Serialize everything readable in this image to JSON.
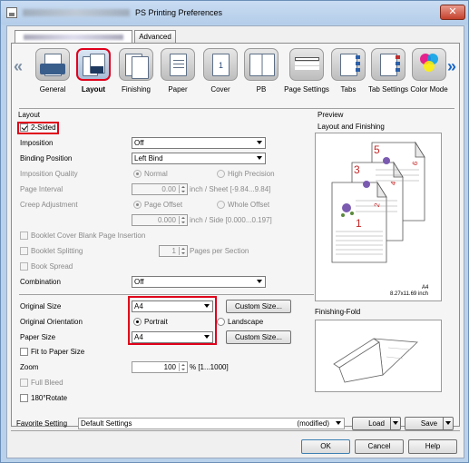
{
  "window": {
    "title": "PS Printing Preferences",
    "close_label": "✕"
  },
  "tabs": [
    {
      "label": ""
    },
    {
      "label": "Advanced"
    }
  ],
  "icon_tabs": [
    {
      "label": "General",
      "icon": "general-icon"
    },
    {
      "label": "Layout",
      "icon": "layout-icon",
      "selected": true
    },
    {
      "label": "Finishing",
      "icon": "finishing-icon"
    },
    {
      "label": "Paper",
      "icon": "paper-icon"
    },
    {
      "label": "Cover",
      "icon": "cover-icon"
    },
    {
      "label": "PB",
      "icon": "pb-icon"
    },
    {
      "label": "Page Settings",
      "icon": "page-settings-icon"
    },
    {
      "label": "Tabs",
      "icon": "tabs-icon"
    },
    {
      "label": "Tab Settings",
      "icon": "tab-settings-icon"
    },
    {
      "label": "Color Mode",
      "icon": "color-mode-icon"
    }
  ],
  "layout": {
    "group_title": "Layout",
    "two_sided": {
      "label": "2-Sided",
      "checked": true
    },
    "imposition": {
      "label": "Imposition",
      "value": "Off"
    },
    "binding_position": {
      "label": "Binding Position",
      "value": "Left Bind"
    },
    "imposition_quality": {
      "label": "Imposition Quality",
      "normal": "Normal",
      "high": "High Precision"
    },
    "page_interval": {
      "label": "Page Interval",
      "value": "0.00",
      "range": "inch / Sheet [-9.84...9.84]"
    },
    "creep_adjustment": {
      "label": "Creep Adjustment",
      "page_offset": "Page Offset",
      "whole_offset": "Whole Offset",
      "value": "0.000",
      "range": "inch / Side [0.000...0.197]"
    },
    "booklet_cover_blank": {
      "label": "Booklet Cover Blank Page Insertion"
    },
    "booklet_splitting": {
      "label": "Booklet Splitting",
      "value": "1",
      "unit": "Pages per Section"
    },
    "book_spread": {
      "label": "Book Spread"
    },
    "combination": {
      "label": "Combination",
      "value": "Off"
    },
    "original_size": {
      "label": "Original Size",
      "value": "A4",
      "button": "Custom Size..."
    },
    "original_orientation": {
      "label": "Original Orientation",
      "portrait": "Portrait",
      "landscape": "Landscape"
    },
    "paper_size": {
      "label": "Paper Size",
      "value": "A4",
      "button": "Custom Size..."
    },
    "fit_to_paper": {
      "label": "Fit to Paper Size"
    },
    "zoom": {
      "label": "Zoom",
      "value": "100",
      "range": "% [1...1000]"
    },
    "full_bleed": {
      "label": "Full Bleed"
    },
    "rotate_180": {
      "label": "180°Rotate"
    }
  },
  "preview": {
    "title": "Preview",
    "layout_finishing": "Layout and Finishing",
    "paper_name": "A4",
    "paper_dims": "8.27x11.69 inch",
    "page_numbers": [
      "5",
      "6",
      "3",
      "4",
      "2",
      "1"
    ],
    "finishing_fold": "Finishing-Fold"
  },
  "favorite": {
    "label": "Favorite Setting",
    "value": "Default Settings",
    "status": "(modified)",
    "load": "Load",
    "save": "Save"
  },
  "dialog_buttons": {
    "ok": "OK",
    "cancel": "Cancel",
    "help": "Help"
  }
}
